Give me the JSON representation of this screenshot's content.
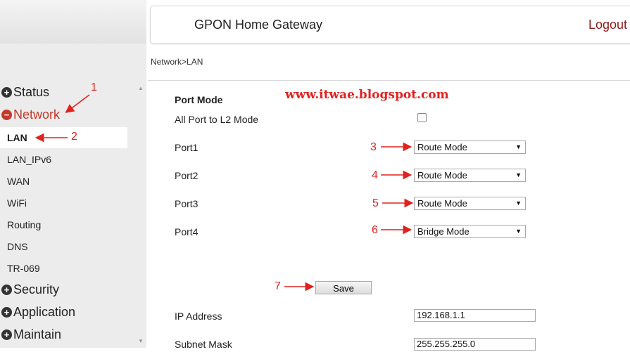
{
  "header": {
    "title": "GPON Home Gateway",
    "logout_label": "Logout"
  },
  "breadcrumb": "Network>LAN",
  "sidebar": {
    "items": [
      {
        "label": "Status",
        "icon": "plus-circle-icon"
      },
      {
        "label": "Network",
        "icon": "minus-circle-icon",
        "active": true
      },
      {
        "label": "LAN",
        "selected": true
      },
      {
        "label": "LAN_IPv6"
      },
      {
        "label": "WAN"
      },
      {
        "label": "WiFi"
      },
      {
        "label": "Routing"
      },
      {
        "label": "DNS"
      },
      {
        "label": "TR-069"
      },
      {
        "label": "Security",
        "icon": "plus-circle-icon"
      },
      {
        "label": "Application",
        "icon": "plus-circle-icon"
      },
      {
        "label": "Maintain",
        "icon": "plus-circle-icon"
      }
    ]
  },
  "form": {
    "port_mode_title": "Port Mode",
    "all_port_label": "All Port to L2 Mode",
    "all_port_checked": false,
    "ports": [
      {
        "label": "Port1",
        "value": "Route Mode"
      },
      {
        "label": "Port2",
        "value": "Route Mode"
      },
      {
        "label": "Port3",
        "value": "Route Mode"
      },
      {
        "label": "Port4",
        "value": "Bridge Mode"
      }
    ],
    "save_label": "Save",
    "ip_label": "IP Address",
    "ip_value": "192.168.1.1",
    "mask_label": "Subnet Mask",
    "mask_value": "255.255.255.0"
  },
  "watermark": "www.itwae.blogspot.com",
  "annotations": [
    "1",
    "2",
    "3",
    "4",
    "5",
    "6",
    "7"
  ],
  "colors": {
    "accent": "#c0392b",
    "annotation": "#e0221f",
    "logout": "#8b1a1a"
  }
}
